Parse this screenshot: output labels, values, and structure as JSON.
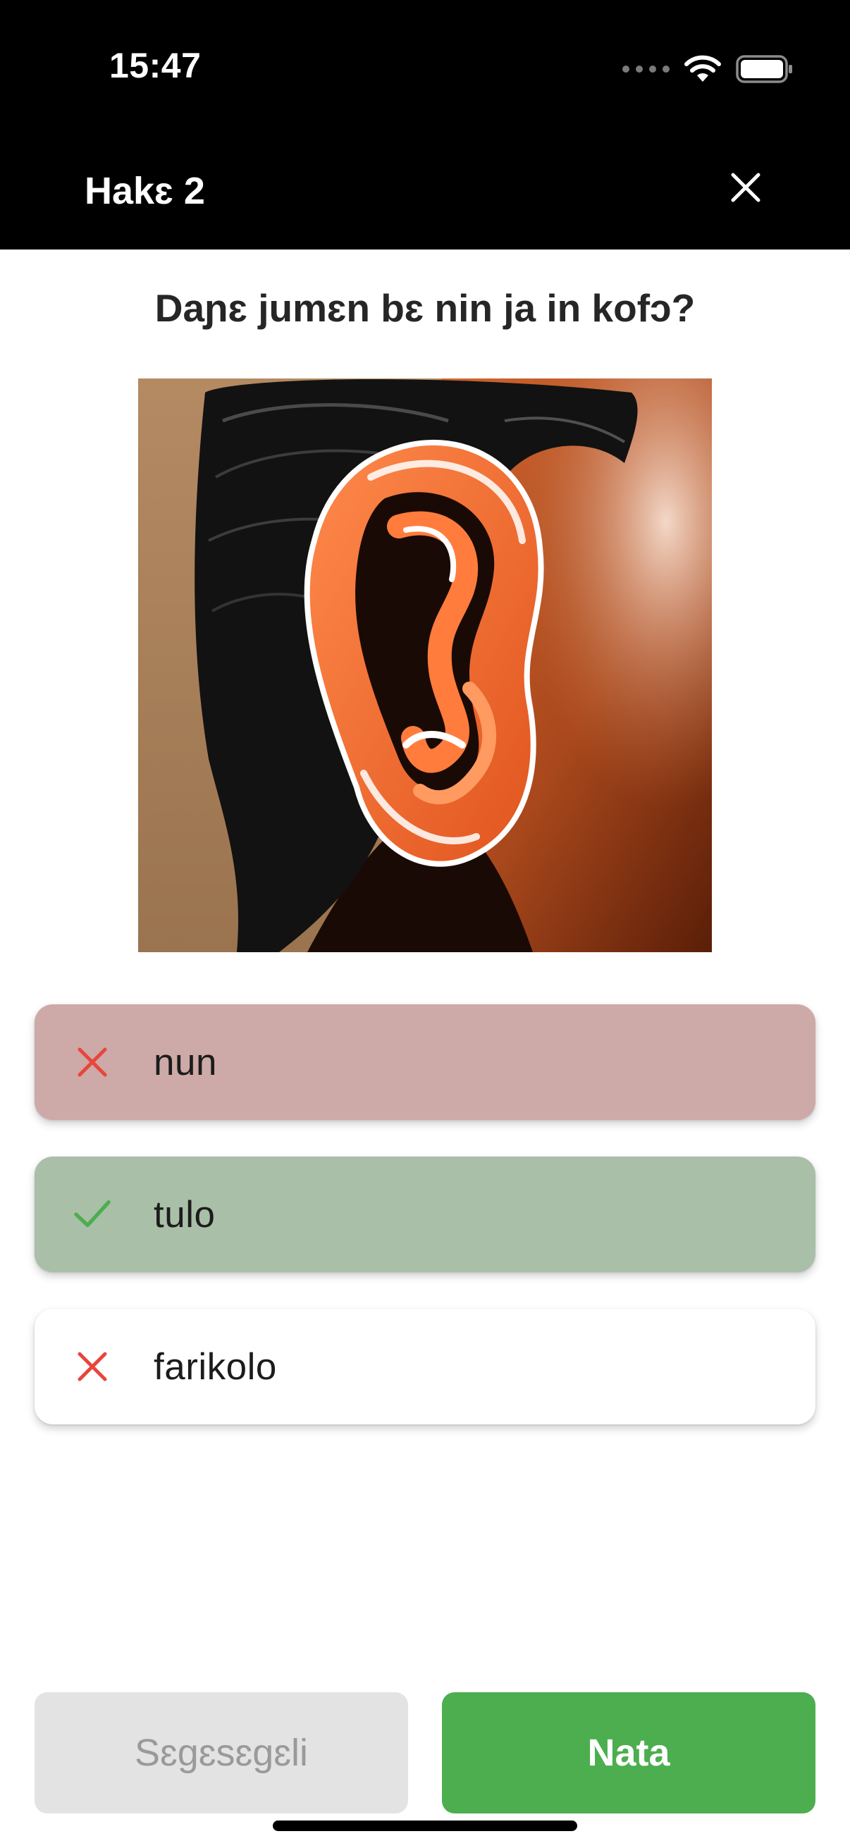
{
  "status_bar": {
    "time": "15:47",
    "icons": [
      "signal-icon",
      "wifi-icon",
      "battery-icon"
    ]
  },
  "header": {
    "title": "Hakɛ 2",
    "close_icon": "close-icon"
  },
  "question": {
    "text": "Daɲɛ jumɛn bɛ nin ja in kofɔ?",
    "image_subject": "ear"
  },
  "answers": [
    {
      "label": "nun",
      "state": "wrong",
      "icon": "x-icon"
    },
    {
      "label": "tulo",
      "state": "correct",
      "icon": "check-icon"
    },
    {
      "label": "farikolo",
      "state": "neutral",
      "icon": "x-icon"
    }
  ],
  "buttons": {
    "secondary_label": "Sɛgɛsɛgɛli",
    "primary_label": "Nata"
  },
  "colors": {
    "wrong_bg": "#cda9a7",
    "correct_bg": "#a9bfa8",
    "primary_green": "#4cae4f",
    "error_red": "#e8453c",
    "success_green": "#4cae4f"
  }
}
